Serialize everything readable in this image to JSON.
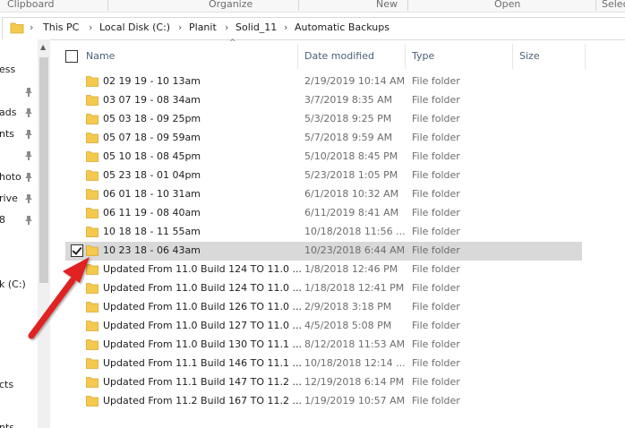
{
  "ribbon": {
    "groups": [
      "Clipboard",
      "Organize",
      "New",
      "Open",
      "Selec"
    ]
  },
  "address": {
    "crumbs": [
      "This PC",
      "Local Disk (C:)",
      "Planit",
      "Solid_11",
      "Automatic Backups"
    ]
  },
  "nav": {
    "items": [
      "ess",
      "ads",
      "nts",
      "hoto",
      "rive",
      "8",
      "k (C:)",
      "cts",
      "nts"
    ]
  },
  "columns": {
    "name": "Name",
    "date": "Date modified",
    "type": "Type",
    "size": "Size"
  },
  "rows": [
    {
      "name": "02 19 19 - 10 13am",
      "date": "2/19/2019 10:14 AM",
      "type": "File folder",
      "selected": false
    },
    {
      "name": "03 07 19 - 08 34am",
      "date": "3/7/2019 8:35 AM",
      "type": "File folder",
      "selected": false
    },
    {
      "name": "05 03 18 - 09 25pm",
      "date": "5/3/2018 9:25 PM",
      "type": "File folder",
      "selected": false
    },
    {
      "name": "05 07 18 - 09 59am",
      "date": "5/7/2018 9:59 AM",
      "type": "File folder",
      "selected": false
    },
    {
      "name": "05 10 18 - 08 45pm",
      "date": "5/10/2018 8:45 PM",
      "type": "File folder",
      "selected": false
    },
    {
      "name": "05 23 18 - 01 04pm",
      "date": "5/23/2018 1:05 PM",
      "type": "File folder",
      "selected": false
    },
    {
      "name": "06 01 18 - 10 31am",
      "date": "6/1/2018 10:32 AM",
      "type": "File folder",
      "selected": false
    },
    {
      "name": "06 11 19 - 08 40am",
      "date": "6/11/2019 8:41 AM",
      "type": "File folder",
      "selected": false
    },
    {
      "name": "10 18 18 - 11 55am",
      "date": "10/18/2018 11:56 ...",
      "type": "File folder",
      "selected": false
    },
    {
      "name": "10 23 18 - 06 43am",
      "date": "10/23/2018 6:44 AM",
      "type": "File folder",
      "selected": true
    },
    {
      "name": "Updated From 11.0 Build 124 TO 11.0 ...",
      "date": "1/8/2018 12:46 PM",
      "type": "File folder",
      "selected": false
    },
    {
      "name": "Updated From 11.0 Build 124 TO 11.0 ...",
      "date": "1/18/2018 12:41 PM",
      "type": "File folder",
      "selected": false
    },
    {
      "name": "Updated From 11.0 Build 126 TO 11.0 ...",
      "date": "2/9/2018 3:18 PM",
      "type": "File folder",
      "selected": false
    },
    {
      "name": "Updated From 11.0 Build 127 TO 11.0 ...",
      "date": "4/5/2018 5:08 PM",
      "type": "File folder",
      "selected": false
    },
    {
      "name": "Updated From 11.0 Build 130 TO 11.1 ...",
      "date": "8/12/2018 11:53 AM",
      "type": "File folder",
      "selected": false
    },
    {
      "name": "Updated From 11.1 Build 146 TO 11.1 ...",
      "date": "10/18/2018 12:14 ...",
      "type": "File folder",
      "selected": false
    },
    {
      "name": "Updated From 11.1 Build 147 TO 11.2 ...",
      "date": "12/19/2018 6:14 PM",
      "type": "File folder",
      "selected": false
    },
    {
      "name": "Updated From 11.2 Build 167 TO 11.2 ...",
      "date": "1/19/2019 10:57 AM",
      "type": "File folder",
      "selected": false
    }
  ],
  "colors": {
    "folder": "#f4c94e",
    "selection": "#d9d9d9",
    "arrow": "#e02020"
  }
}
